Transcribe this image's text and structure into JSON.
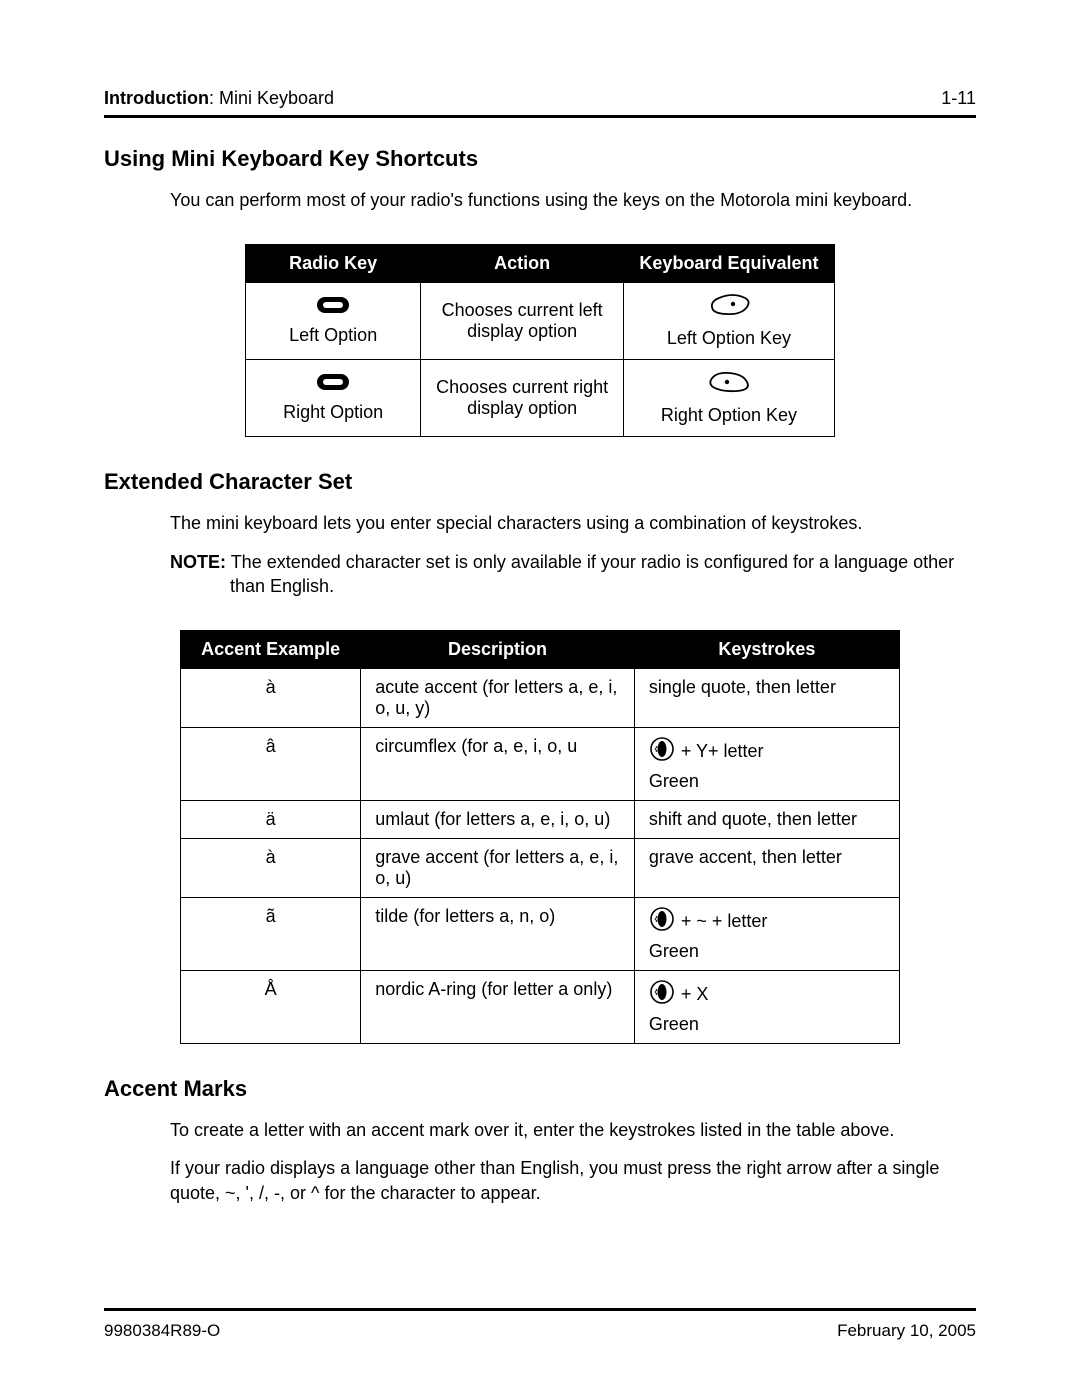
{
  "header": {
    "section_bold": "Introduction",
    "section_rest": ": Mini Keyboard",
    "page_num": "1-11"
  },
  "sec1": {
    "title": "Using Mini Keyboard Key Shortcuts",
    "intro": "You can perform most of your radio's functions using the keys on the Motorola mini keyboard."
  },
  "t1": {
    "h1": "Radio Key",
    "h2": "Action",
    "h3": "Keyboard Equivalent",
    "r1": {
      "label": "Left Option",
      "action": "Chooses current left display option",
      "equiv": "Left Option Key"
    },
    "r2": {
      "label": "Right Option",
      "action": "Chooses current right display option",
      "equiv": "Right Option Key"
    }
  },
  "sec2": {
    "title": "Extended Character Set",
    "intro": "The mini keyboard lets you enter special characters using a combination of keystrokes.",
    "note_label": "NOTE:",
    "note_body": "The extended character set is only available if your radio is configured for a language other than English."
  },
  "t2": {
    "h1": "Accent Example",
    "h2": "Description",
    "h3": "Keystrokes",
    "rows": [
      {
        "ex": "à",
        "desc": "acute accent (for letters a, e, i, o, u, y)",
        "ks": "single quote, then letter",
        "icon": false,
        "sub": ""
      },
      {
        "ex": "â",
        "desc": "circumflex (for a, e, i, o, u",
        "ks": "+ Y+ letter",
        "icon": true,
        "sub": "Green"
      },
      {
        "ex": "ä",
        "desc": "umlaut (for letters a, e, i, o, u)",
        "ks": "shift and quote, then letter",
        "icon": false,
        "sub": ""
      },
      {
        "ex": "à",
        "desc": "grave accent (for letters a, e, i, o, u)",
        "ks": "grave accent, then letter",
        "icon": false,
        "sub": ""
      },
      {
        "ex": "ã",
        "desc": "tilde (for letters a, n, o)",
        "ks": "+ ~ + letter",
        "icon": true,
        "sub": "Green"
      },
      {
        "ex": "Å",
        "desc": "nordic A-ring (for letter a only)",
        "ks": "+ X",
        "icon": true,
        "sub": "Green"
      }
    ]
  },
  "sec3": {
    "title": "Accent Marks",
    "p1": "To create a letter with an accent mark over it, enter the keystrokes listed in the table above.",
    "p2": "If your radio displays a language other than English, you must press the right arrow after a single quote, ~, ', /, -, or ^ for the character to appear."
  },
  "footer": {
    "doc": "9980384R89-O",
    "date": "February 10, 2005"
  }
}
